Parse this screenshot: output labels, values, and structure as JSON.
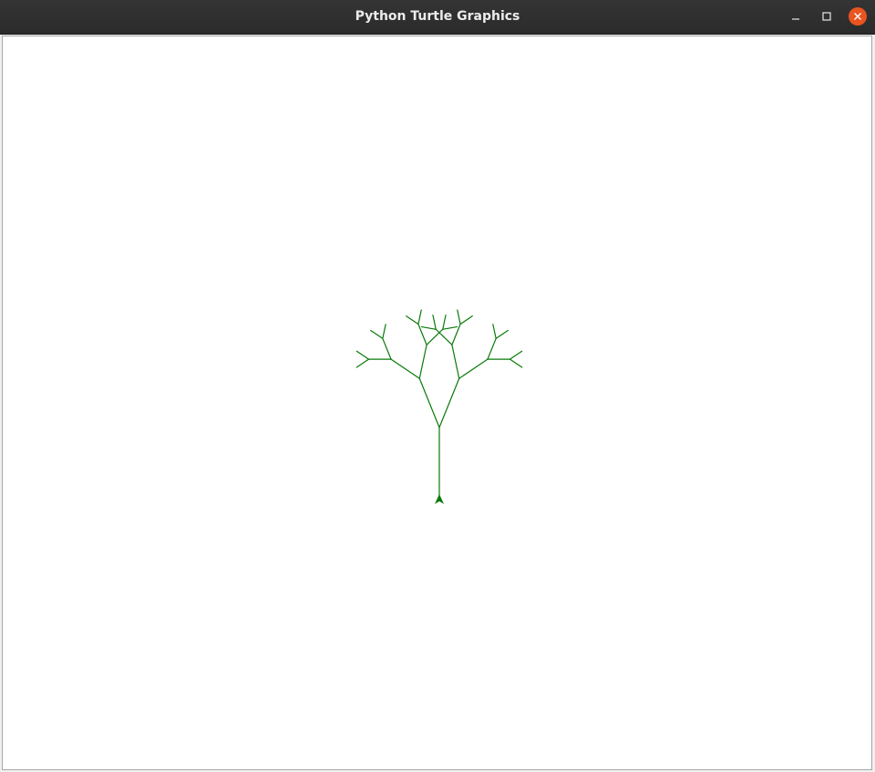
{
  "window": {
    "title": "Python Turtle Graphics",
    "controls": {
      "minimize_icon": "minimize-icon",
      "maximize_icon": "maximize-icon",
      "close_icon": "close-icon"
    }
  },
  "canvas": {
    "background": "#ffffff",
    "pen_color": "#0a7a0a",
    "turtle_color": "#0a7a0a",
    "drawing": "fractal-tree"
  }
}
